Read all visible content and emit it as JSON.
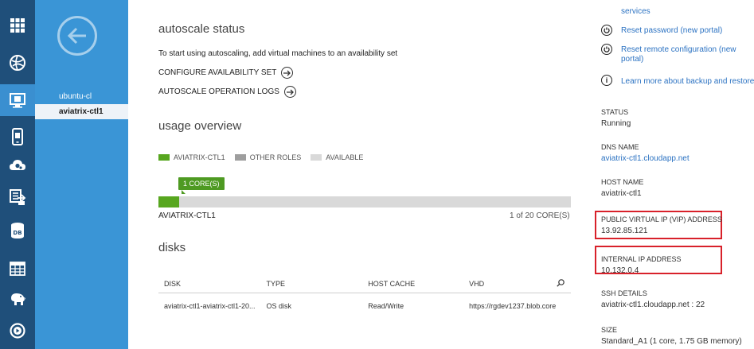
{
  "nav_rail": {
    "items": [
      {
        "icon": "all-items-grid-icon"
      },
      {
        "icon": "web-sites-globe-icon"
      },
      {
        "icon": "virtual-machines-monitor-icon"
      },
      {
        "icon": "mobile-services-icon"
      },
      {
        "icon": "cloud-services-icon"
      },
      {
        "icon": "batch-icon"
      },
      {
        "icon": "sql-databases-db-icon",
        "text": "DB"
      },
      {
        "icon": "storage-table-icon"
      },
      {
        "icon": "hdinsight-elephant-icon"
      },
      {
        "icon": "media-services-icon"
      }
    ]
  },
  "vm_list": {
    "items": [
      {
        "label": "ubuntu-cl"
      },
      {
        "label": "aviatrix-ctl1"
      }
    ]
  },
  "autoscale": {
    "title": "autoscale status",
    "description": "To start using autoscaling, add virtual machines to an availability set",
    "configure_label": "CONFIGURE AVAILABILITY SET",
    "logs_label": "AUTOSCALE OPERATION LOGS"
  },
  "usage": {
    "title": "usage overview",
    "legend": [
      {
        "label": "AVIATRIX-CTL1",
        "color": "#57a61f"
      },
      {
        "label": "OTHER ROLES",
        "color": "#9e9e9e"
      },
      {
        "label": "AVAILABLE",
        "color": "#d9d9d9"
      }
    ],
    "tooltip": "1 CORE(S)",
    "fill_fraction": 0.05,
    "bar_name": "AVIATRIX-CTL1",
    "bar_count": "1 of 20 CORE(S)"
  },
  "disks": {
    "title": "disks",
    "columns": [
      "DISK",
      "TYPE",
      "HOST CACHE",
      "VHD"
    ],
    "rows": [
      [
        "aviatrix-ctl1-aviatrix-ctl1-20...",
        "OS disk",
        "Read/Write",
        "https://rgdev1237.blob.core"
      ]
    ]
  },
  "quick_links": {
    "services_label": "services",
    "reset_password": "Reset password (new portal)",
    "reset_remote_line1": "Reset remote configuration (new",
    "reset_remote_line2": "portal)",
    "learn_more": "Learn more about backup and restore"
  },
  "details": {
    "status_label": "STATUS",
    "status_value": "Running",
    "dns_label": "DNS NAME",
    "dns_value": "aviatrix-ctl1.cloudapp.net",
    "host_label": "HOST NAME",
    "host_value": "aviatrix-ctl1",
    "vip_label": "PUBLIC VIRTUAL IP (VIP) ADDRESS",
    "vip_value": "13.92.85.121",
    "internal_label": "INTERNAL IP ADDRESS",
    "internal_value": "10.132.0.4",
    "ssh_label": "SSH DETAILS",
    "ssh_value": "aviatrix-ctl1.cloudapp.net : 22",
    "size_label": "SIZE",
    "size_value": "Standard_A1 (1 core, 1.75 GB memory)"
  }
}
